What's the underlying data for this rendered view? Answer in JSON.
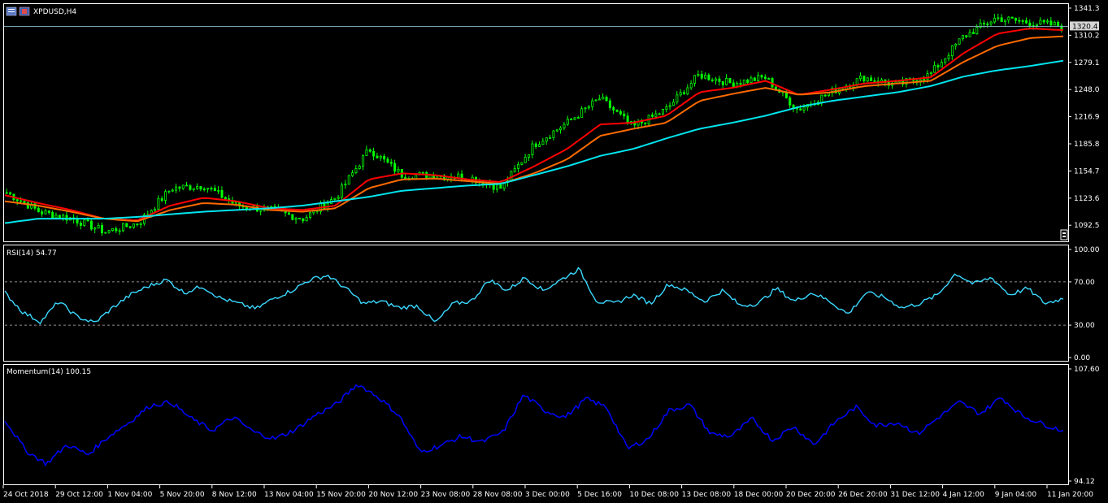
{
  "symbol_title": "XPDUSD,H4",
  "current_price_label": "1320.4",
  "colors": {
    "background": "#000000",
    "frame": "#ffffff",
    "candle_up": "#00ff00",
    "candle_down": "#00ff00",
    "ma_fast": "#ff0000",
    "ma_mid": "#ff6a00",
    "ma_slow": "#00e5ee",
    "rsi_line": "#3ad9ff",
    "momentum_line": "#0000ff",
    "price_line": "#8ab6c9"
  },
  "chart_data": [
    {
      "type": "candlestick",
      "title": "XPDUSD,H4",
      "y_ticks": [
        "1341.3",
        "1310.2",
        "1279.1",
        "1248.0",
        "1216.9",
        "1185.8",
        "1154.7",
        "1123.6",
        "1092.5"
      ],
      "ylim": [
        1075,
        1345
      ],
      "last_price": 1320.4,
      "x_tick_labels": [
        "24 Oct 2018",
        "29 Oct 12:00",
        "1 Nov 04:00",
        "5 Nov 20:00",
        "8 Nov 12:00",
        "13 Nov 04:00",
        "15 Nov 20:00",
        "20 Nov 12:00",
        "23 Nov 08:00",
        "28 Nov 08:00",
        "3 Dec 00:00",
        "5 Dec 16:00",
        "10 Dec 08:00",
        "13 Dec 08:00",
        "18 Dec 00:00",
        "20 Dec 20:00",
        "26 Dec 20:00",
        "31 Dec 12:00",
        "4 Jan 12:00",
        "9 Jan 04:00",
        "11 Jan 20:00"
      ],
      "close_anchors": [
        1130,
        1108,
        1100,
        1085,
        1095,
        1135,
        1138,
        1115,
        1110,
        1100,
        1125,
        1180,
        1150,
        1150,
        1148,
        1135,
        1185,
        1210,
        1238,
        1205,
        1225,
        1265,
        1255,
        1262,
        1225,
        1245,
        1262,
        1253,
        1265,
        1308,
        1330,
        1325,
        1321
      ],
      "series": [
        {
          "name": "",
          "kind": "ma",
          "color_key": "ma_fast",
          "anchors": [
            1127,
            1118,
            1110,
            1100,
            1098,
            1115,
            1124,
            1120,
            1112,
            1110,
            1115,
            1145,
            1152,
            1150,
            1145,
            1142,
            1160,
            1180,
            1208,
            1210,
            1218,
            1245,
            1250,
            1258,
            1242,
            1248,
            1255,
            1258,
            1262,
            1290,
            1312,
            1318,
            1316
          ]
        },
        {
          "name": "",
          "kind": "ma",
          "color_key": "ma_mid",
          "anchors": [
            1120,
            1115,
            1108,
            1100,
            1097,
            1110,
            1118,
            1116,
            1110,
            1108,
            1112,
            1135,
            1145,
            1146,
            1143,
            1140,
            1152,
            1168,
            1195,
            1203,
            1210,
            1235,
            1243,
            1250,
            1242,
            1245,
            1252,
            1255,
            1258,
            1280,
            1298,
            1307,
            1309
          ]
        },
        {
          "name": "",
          "kind": "ma",
          "color_key": "ma_slow",
          "anchors": [
            1095,
            1100,
            1100,
            1100,
            1102,
            1105,
            1108,
            1110,
            1112,
            1115,
            1120,
            1125,
            1132,
            1135,
            1138,
            1140,
            1150,
            1160,
            1172,
            1180,
            1192,
            1203,
            1210,
            1218,
            1228,
            1235,
            1240,
            1245,
            1252,
            1263,
            1270,
            1275,
            1281
          ]
        }
      ]
    },
    {
      "type": "line",
      "title": "RSI(14) 54.77",
      "ylim": [
        0,
        100
      ],
      "y_ticks": [
        "100.00",
        "70.00",
        "30.00",
        "0.00"
      ],
      "levels": [
        70,
        30
      ],
      "series": [
        {
          "name": "RSI(14)",
          "values": [
            60,
            42,
            33,
            52,
            38,
            32,
            46,
            58,
            66,
            72,
            60,
            66,
            55,
            50,
            45,
            55,
            62,
            72,
            76,
            64,
            50,
            52,
            46,
            48,
            32,
            50,
            52,
            72,
            62,
            74,
            62,
            72,
            82,
            52,
            50,
            58,
            50,
            68,
            62,
            52,
            62,
            48,
            50,
            64,
            52,
            60,
            52,
            40,
            60,
            56,
            46,
            50,
            58,
            78,
            68,
            74,
            58,
            64,
            50,
            54.77
          ]
        }
      ]
    },
    {
      "type": "line",
      "title": "Momentum(14) 100.15",
      "ylim": [
        94.12,
        107.6
      ],
      "y_ticks": [
        "107.60",
        "94.12"
      ],
      "series": [
        {
          "name": "Momentum(14)",
          "values": [
            101.5,
            97.8,
            96.2,
            98.5,
            97.3,
            99.5,
            101.2,
            103.2,
            103.6,
            101.6,
            100.2,
            101.8,
            100.0,
            99.2,
            100.3,
            102.1,
            103.4,
            105.8,
            104.2,
            102.0,
            97.6,
            98.4,
            99.5,
            98.8,
            100.0,
            104.5,
            102.6,
            101.8,
            104.0,
            103.0,
            98.0,
            99.2,
            102.6,
            103.3,
            99.8,
            99.5,
            101.6,
            99.0,
            100.7,
            98.5,
            101.2,
            103.0,
            100.8,
            101.2,
            99.8,
            101.8,
            103.6,
            102.2,
            104.2,
            102.0,
            101.0,
            100.15
          ]
        }
      ]
    }
  ]
}
